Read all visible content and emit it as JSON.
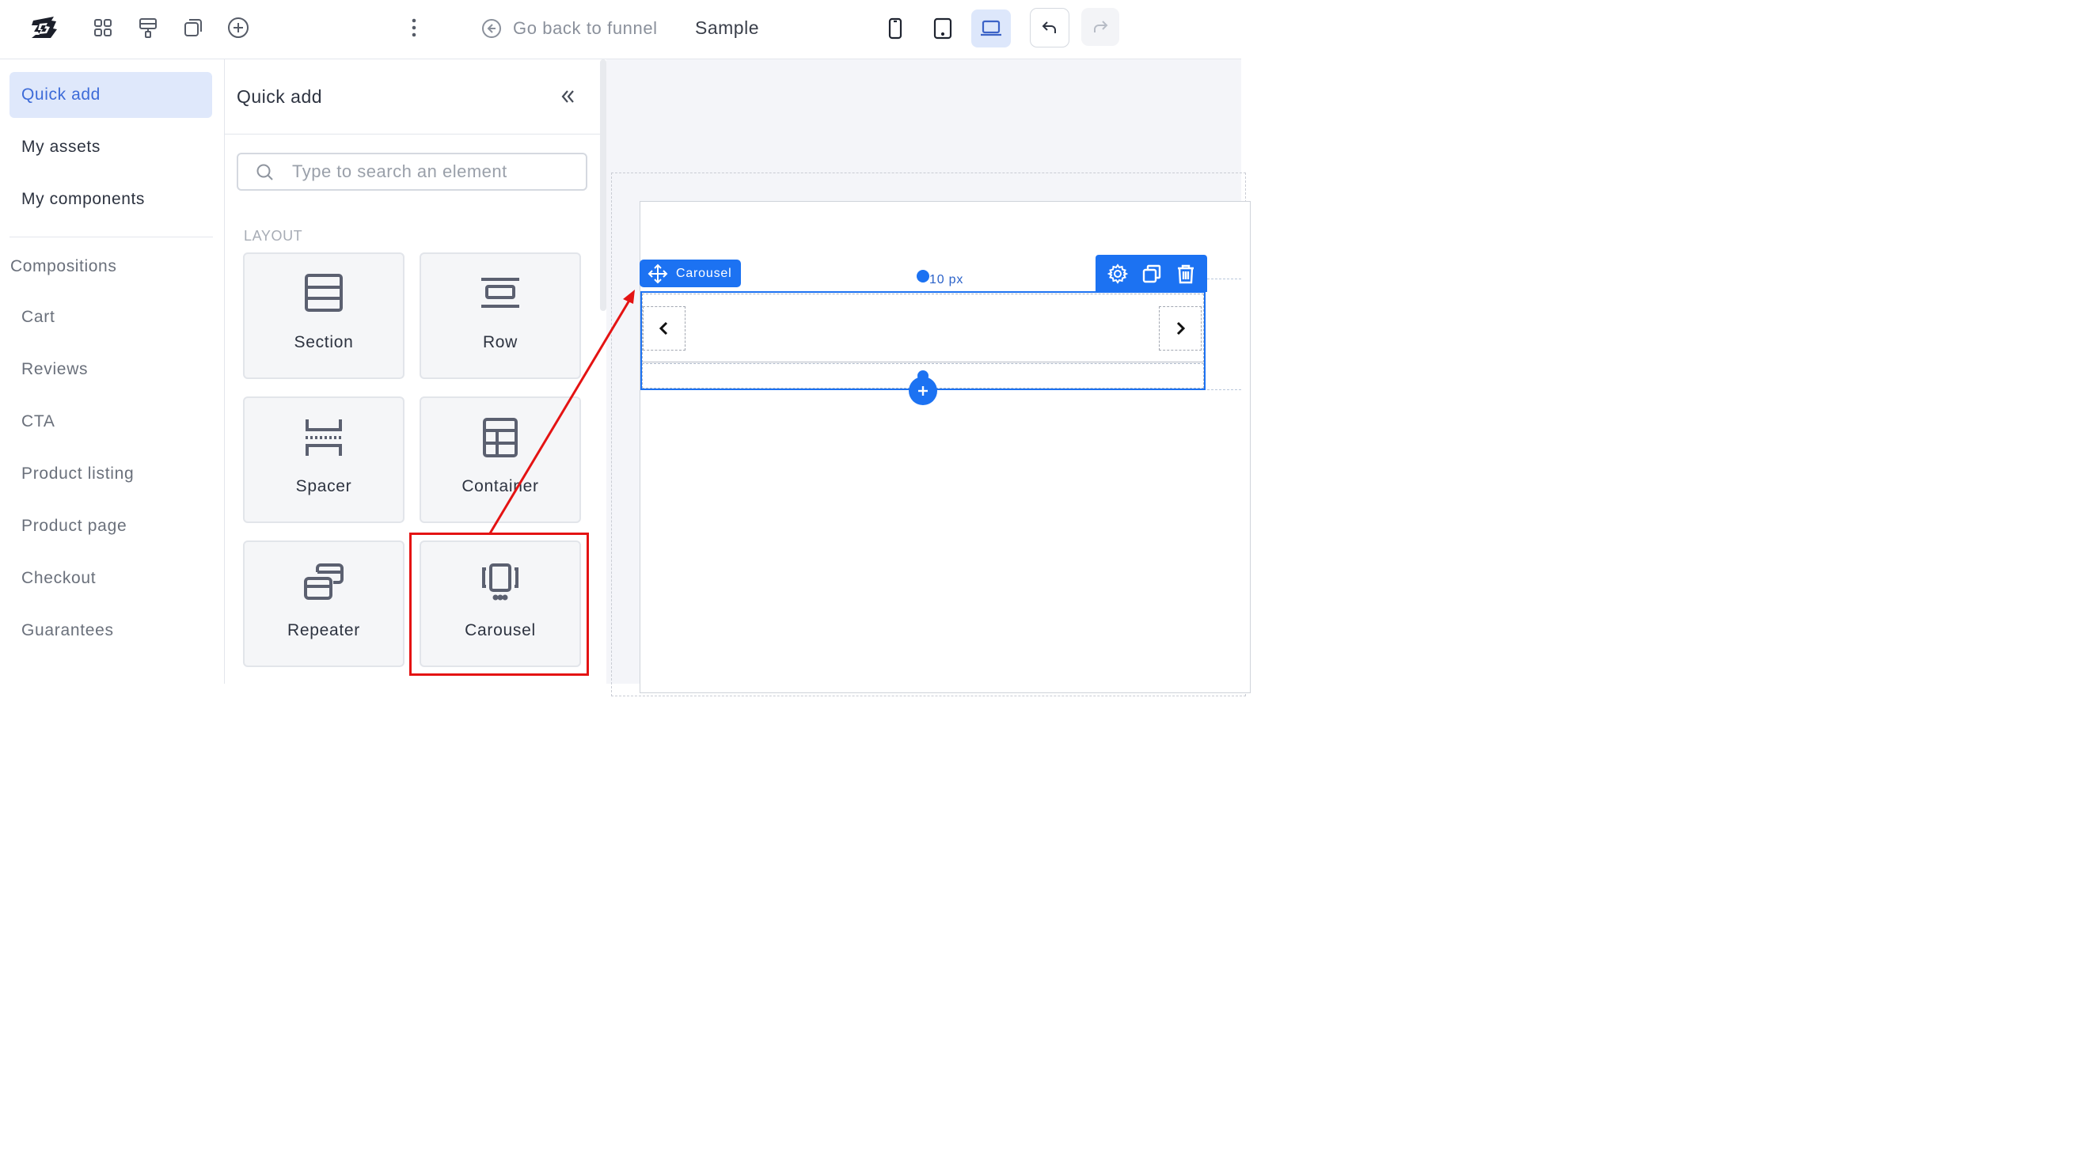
{
  "topbar": {
    "go_back_label": "Go back to funnel",
    "page_name": "Sample",
    "icons": [
      "logo",
      "grid-icon",
      "paint-roller-icon",
      "copy-icon",
      "plus-circle-icon",
      "more-vertical-icon",
      "arrow-left-circle-icon",
      "mobile-icon",
      "tablet-icon",
      "laptop-icon",
      "undo-icon",
      "redo-icon"
    ],
    "active_device": "desktop"
  },
  "leftnav": {
    "items": [
      {
        "label": "Quick add",
        "active": true
      },
      {
        "label": "My assets",
        "active": false
      },
      {
        "label": "My components",
        "active": false
      }
    ],
    "section_title": "Compositions",
    "compositions": [
      "Cart",
      "Reviews",
      "CTA",
      "Product listing",
      "Product page",
      "Checkout",
      "Guarantees"
    ]
  },
  "panel": {
    "title": "Quick add",
    "search_placeholder": "Type to search an element",
    "layout_label": "LAYOUT",
    "tiles": [
      {
        "label": "Section",
        "icon": "section-icon"
      },
      {
        "label": "Row",
        "icon": "row-icon"
      },
      {
        "label": "Spacer",
        "icon": "spacer-icon"
      },
      {
        "label": "Container",
        "icon": "container-icon"
      },
      {
        "label": "Repeater",
        "icon": "repeater-icon"
      },
      {
        "label": "Carousel",
        "icon": "carousel-icon"
      }
    ]
  },
  "canvas": {
    "selected_element_label": "Carousel",
    "padding_label": "10 px",
    "toolbar_icons": [
      "settings-icon",
      "duplicate-icon",
      "trash-icon"
    ]
  },
  "colors": {
    "accent": "#1c72f2",
    "nav_active_bg": "#dfe8fb",
    "annotation": "#e41313"
  }
}
